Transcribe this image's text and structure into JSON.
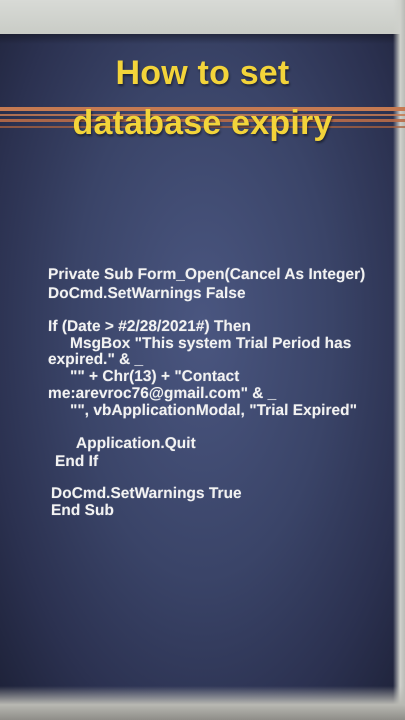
{
  "title": {
    "line1": "How to set",
    "line2": "database expiry"
  },
  "code": {
    "lines": [
      "Private Sub Form_Open(Cancel As Integer)",
      "DoCmd.SetWarnings False",
      "If (Date > #2/28/2021#) Then",
      "MsgBox \"This system Trial Period has",
      "expired.\" & _",
      "\"\" + Chr(13) + \"Contact",
      "me:arevroc76@gmail.com\" & _",
      "\"\", vbApplicationModal, \"Trial Expired\"",
      "Application.Quit",
      "End If",
      "DoCmd.SetWarnings True",
      "End Sub"
    ]
  }
}
